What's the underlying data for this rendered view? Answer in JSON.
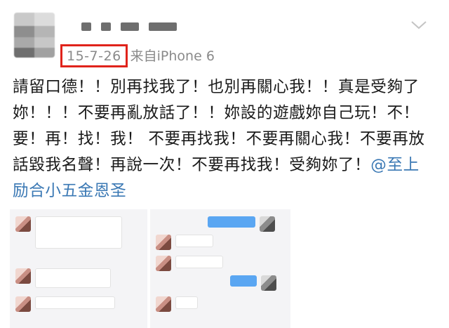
{
  "post": {
    "date": "15-7-26",
    "source": "来自iPhone 6",
    "text_before_mention": "請留口德！！別再找我了！也別再關心我！！真是受夠了妳！！！不要再亂放話了！！妳設的遊戲妳自己玩！不！要！再！找！我！ 不要再找我！不要再關心我！不要再放話毀我名聲！再說一次！不要再找我！受夠妳了！",
    "mention": "@至上励合小五金恩圣"
  },
  "icons": {
    "more": "chevron-down-icon"
  },
  "colors": {
    "highlight_border": "#e0231b",
    "mention": "#3a78b4",
    "chat_blue": "#5aa6f2"
  }
}
